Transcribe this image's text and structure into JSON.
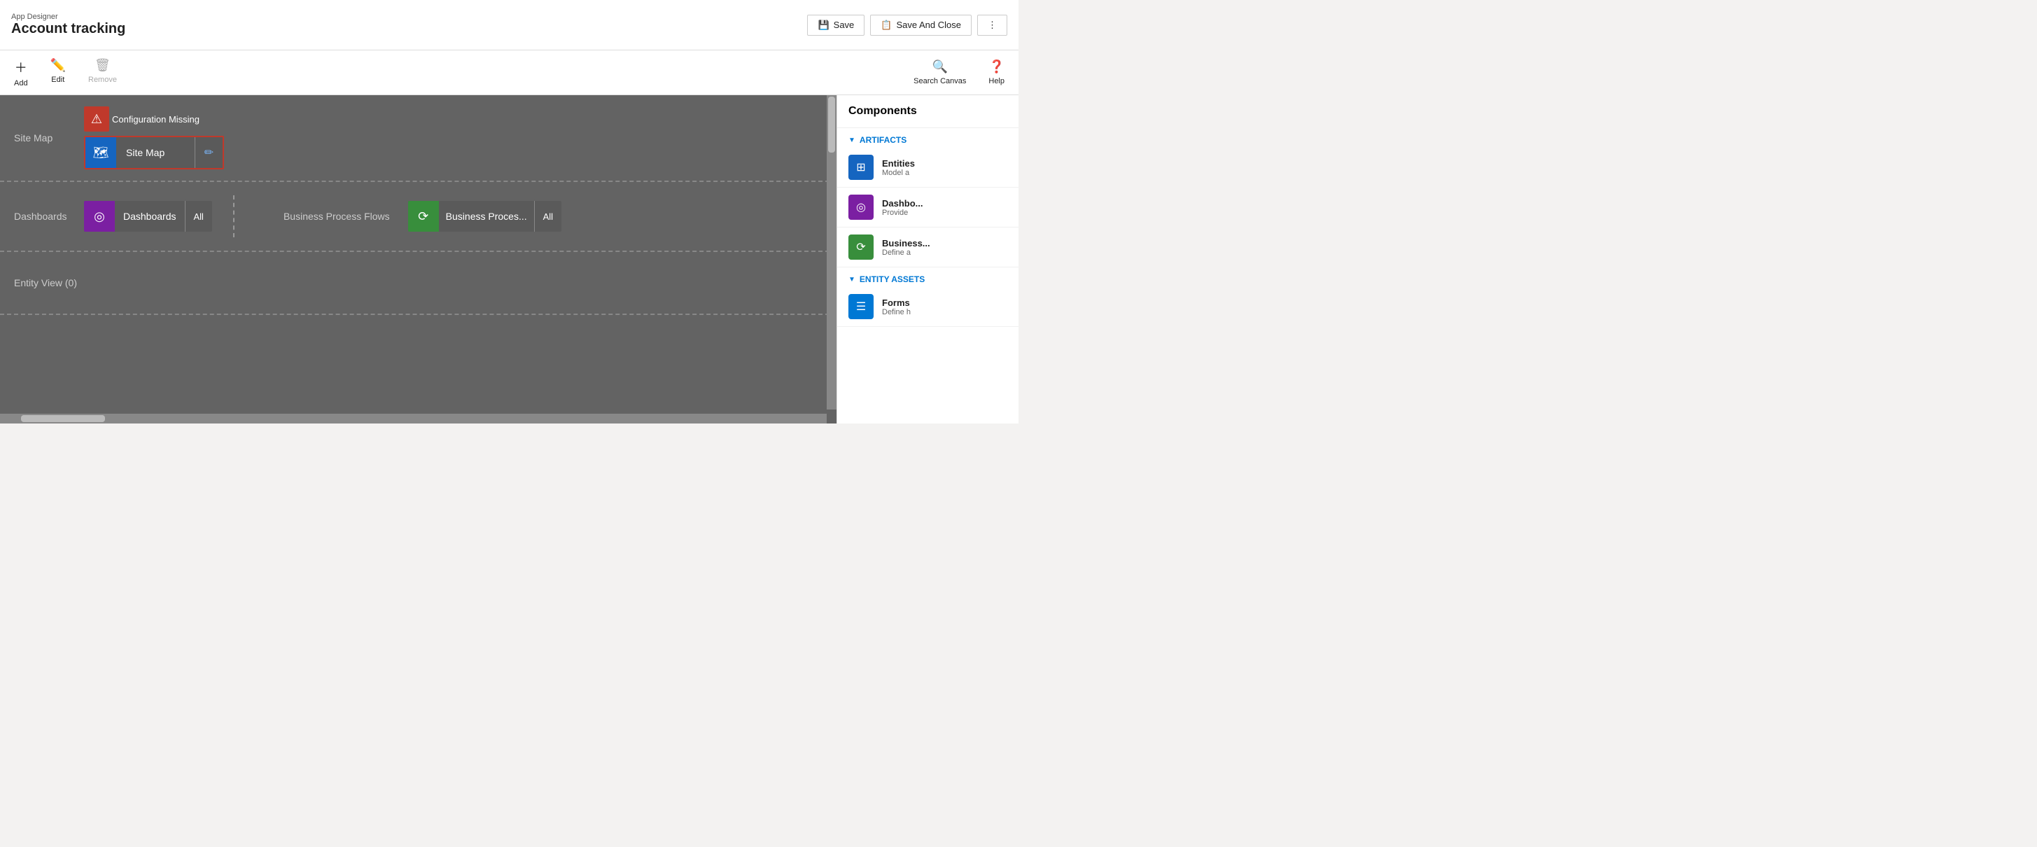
{
  "header": {
    "app_label": "App Designer",
    "title": "Account tracking",
    "save_label": "Save",
    "save_close_label": "Save And Close"
  },
  "toolbar": {
    "add_label": "Add",
    "edit_label": "Edit",
    "remove_label": "Remove",
    "search_canvas_label": "Search Canvas",
    "help_label": "Help"
  },
  "canvas": {
    "site_map_label": "Site Map",
    "config_missing": "Configuration Missing",
    "site_map_card_name": "Site Map",
    "dashboards_label": "Dashboards",
    "dashboards_card_name": "Dashboards",
    "dashboards_all": "All",
    "bpf_label": "Business Process Flows",
    "bpf_card_name": "Business Proces...",
    "bpf_all": "All",
    "entity_view_label": "Entity View (0)"
  },
  "components": {
    "title": "Components",
    "artifacts_label": "ARTIFACTS",
    "entity_assets_label": "ENTITY ASSETS",
    "items": [
      {
        "name": "Entities",
        "desc": "Model a",
        "icon_type": "blue",
        "icon": "⊞"
      },
      {
        "name": "Dashbo...",
        "desc": "Provide",
        "icon_type": "purple",
        "icon": "◎"
      },
      {
        "name": "Business...",
        "desc": "Define a",
        "icon_type": "green",
        "icon": "⟳"
      },
      {
        "name": "Forms",
        "desc": "Define h",
        "icon_type": "blue2",
        "icon": "☰"
      }
    ]
  }
}
